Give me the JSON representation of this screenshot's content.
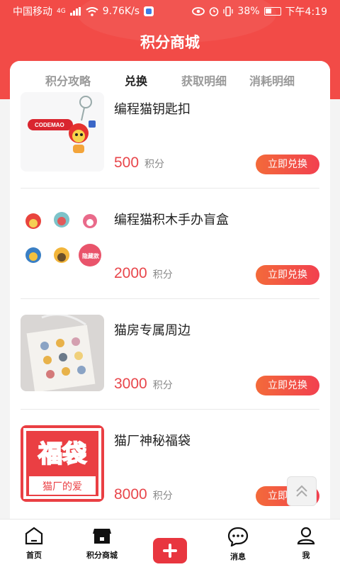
{
  "status_bar": {
    "carrier": "中国移动",
    "network": "4G",
    "speed": "9.76K/s",
    "battery": "38%",
    "time": "下午4:19"
  },
  "header": {
    "title": "积分商城"
  },
  "tabs": [
    {
      "label": "积分攻略",
      "active": false
    },
    {
      "label": "兑换",
      "active": true
    },
    {
      "label": "获取明细",
      "active": false
    },
    {
      "label": "消耗明细",
      "active": false
    }
  ],
  "items": [
    {
      "title": "编程猫钥匙扣",
      "points": "500",
      "unit": "积分",
      "button": "立即兑换",
      "thumb_tag": "CODEMAO"
    },
    {
      "title": "编程猫积木手办盲盒",
      "points": "2000",
      "unit": "积分",
      "button": "立即兑换",
      "thumb_tag": "隐藏款"
    },
    {
      "title": "猫房专属周边",
      "points": "3000",
      "unit": "积分",
      "button": "立即兑换"
    },
    {
      "title": "猫厂神秘福袋",
      "points": "8000",
      "unit": "积分",
      "button": "立即兑换",
      "thumb_tag": "福袋",
      "thumb_subtag": "猫厂的爱"
    }
  ],
  "tabbar": [
    {
      "label": "首页",
      "icon": "home-icon"
    },
    {
      "label": "积分商城",
      "icon": "shop-icon"
    },
    {
      "label": "",
      "icon": "plus-icon"
    },
    {
      "label": "消息",
      "icon": "message-icon"
    },
    {
      "label": "我",
      "icon": "profile-icon"
    }
  ],
  "colors": {
    "primary_red": "#f24b47",
    "price_red": "#e8464b",
    "button_gradient_start": "#f36a3a",
    "button_gradient_end": "#f2404f"
  }
}
